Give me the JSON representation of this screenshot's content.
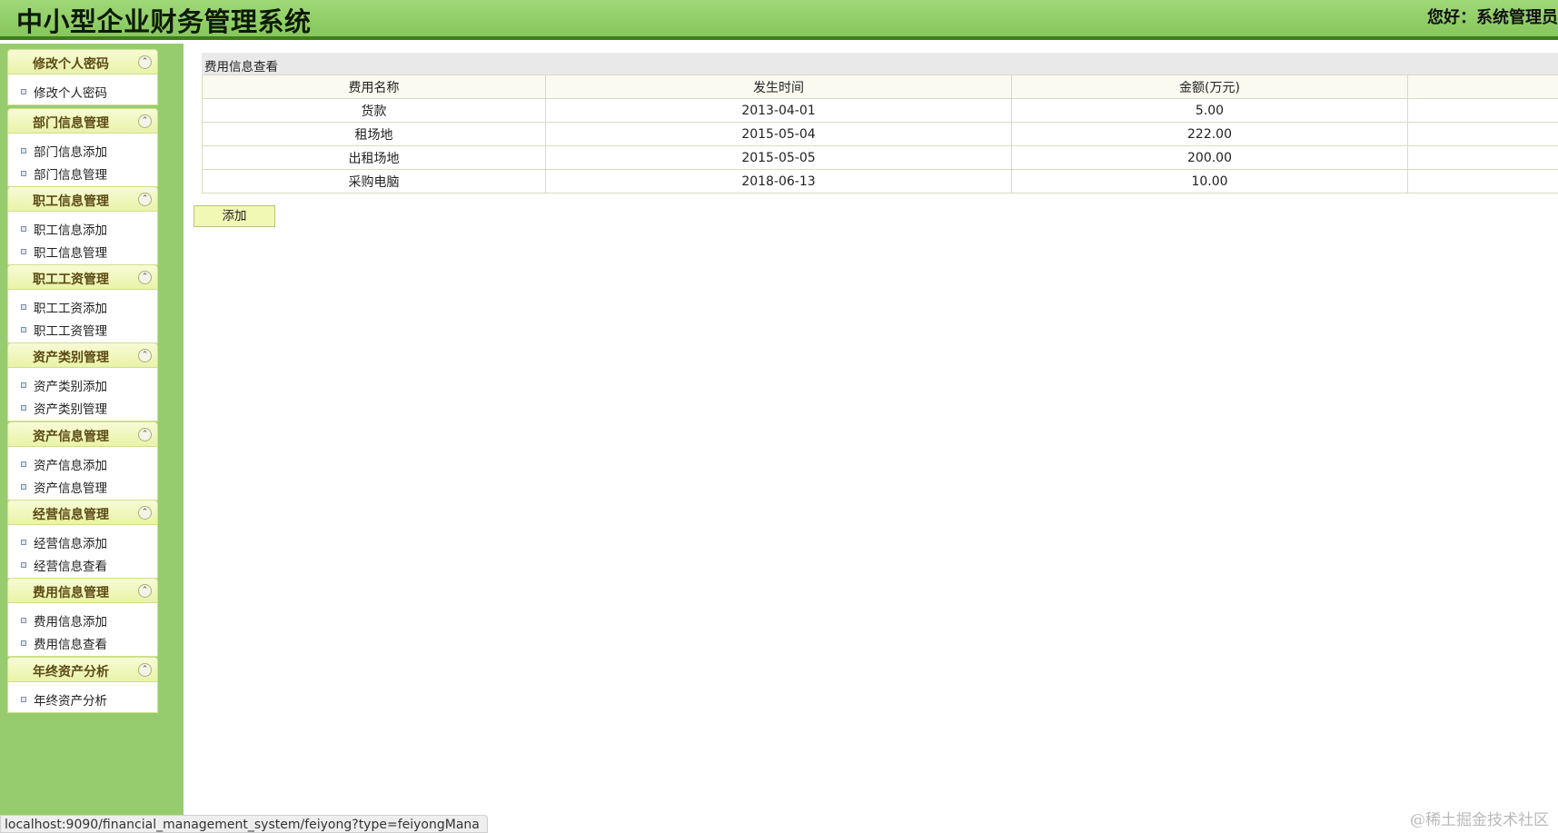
{
  "header": {
    "title": "中小型企业财务管理系统",
    "greeting": "您好：系统管理员"
  },
  "sidebar": {
    "groups": [
      {
        "title": "修改个人密码",
        "items": [
          "修改个人密码"
        ]
      },
      {
        "title": "部门信息管理",
        "items": [
          "部门信息添加",
          "部门信息管理"
        ]
      },
      {
        "title": "职工信息管理",
        "items": [
          "职工信息添加",
          "职工信息管理"
        ]
      },
      {
        "title": "职工工资管理",
        "items": [
          "职工工资添加",
          "职工工资管理"
        ]
      },
      {
        "title": "资产类别管理",
        "items": [
          "资产类别添加",
          "资产类别管理"
        ]
      },
      {
        "title": "资产信息管理",
        "items": [
          "资产信息添加",
          "资产信息管理"
        ]
      },
      {
        "title": "经营信息管理",
        "items": [
          "经营信息添加",
          "经营信息查看"
        ]
      },
      {
        "title": "费用信息管理",
        "items": [
          "费用信息添加",
          "费用信息查看"
        ]
      },
      {
        "title": "年终资产分析",
        "items": [
          "年终资产分析"
        ]
      }
    ]
  },
  "main": {
    "panel_title": "费用信息查看",
    "columns": [
      "费用名称",
      "发生时间",
      "金额(万元)",
      ""
    ],
    "rows": [
      [
        "货款",
        "2013-04-01",
        "5.00",
        ""
      ],
      [
        "租场地",
        "2015-05-04",
        "222.00",
        ""
      ],
      [
        "出租场地",
        "2015-05-05",
        "200.00",
        ""
      ],
      [
        "采购电脑",
        "2018-06-13",
        "10.00",
        ""
      ]
    ],
    "add_button": "添加"
  },
  "status_bar": {
    "url": "localhost:9090/financial_management_system/feiyong?type=feiyongMana"
  },
  "watermark": "@稀土掘金技术社区",
  "icons": {
    "group_toggle": "chevron-up-double-icon",
    "menu_bullet": "square-bullet-icon"
  },
  "colors": {
    "header_green": "#93d069",
    "header_border": "#3f7f1a",
    "sidebar_green": "#96cc6e",
    "group_header": "#eef6b8",
    "button_fill": "#f0f8b4"
  }
}
